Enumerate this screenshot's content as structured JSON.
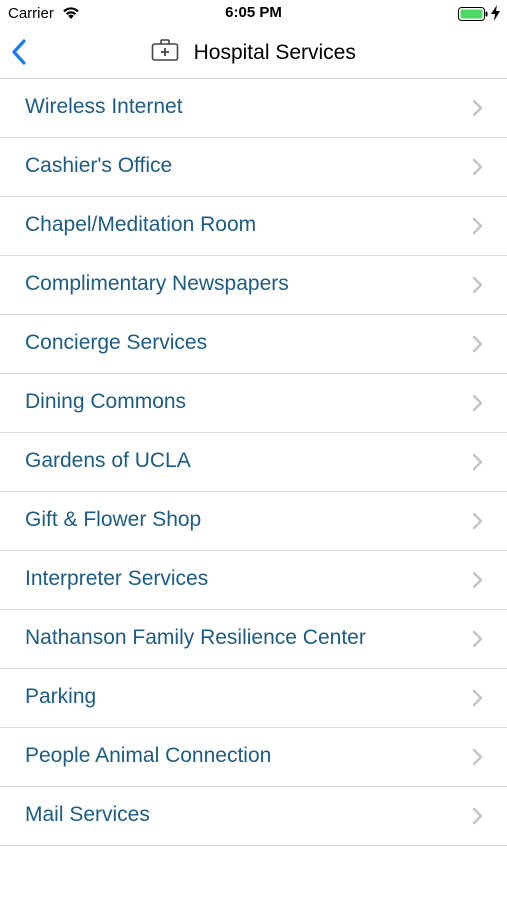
{
  "status_bar": {
    "carrier": "Carrier",
    "time": "6:05 PM",
    "icons": [
      "wifi-icon",
      "battery-icon",
      "charging-bolt-icon"
    ],
    "battery_color": "#4cd964"
  },
  "nav": {
    "title": "Hospital Services",
    "back_icon": "chevron-left-icon",
    "title_icon": "medical-kit-icon",
    "accent_color": "#1a7cf2"
  },
  "services": {
    "items": [
      {
        "label": "Wireless Internet"
      },
      {
        "label": "Cashier's Office"
      },
      {
        "label": "Chapel/Meditation Room"
      },
      {
        "label": "Complimentary Newspapers"
      },
      {
        "label": "Concierge Services"
      },
      {
        "label": "Dining Commons"
      },
      {
        "label": "Gardens of UCLA"
      },
      {
        "label": "Gift & Flower Shop"
      },
      {
        "label": "Interpreter Services"
      },
      {
        "label": "Nathanson Family Resilience Center"
      },
      {
        "label": "Parking"
      },
      {
        "label": "People Animal Connection"
      },
      {
        "label": "Mail Services"
      }
    ],
    "row_icon": "chevron-right-icon",
    "text_color": "#1c5c84"
  }
}
